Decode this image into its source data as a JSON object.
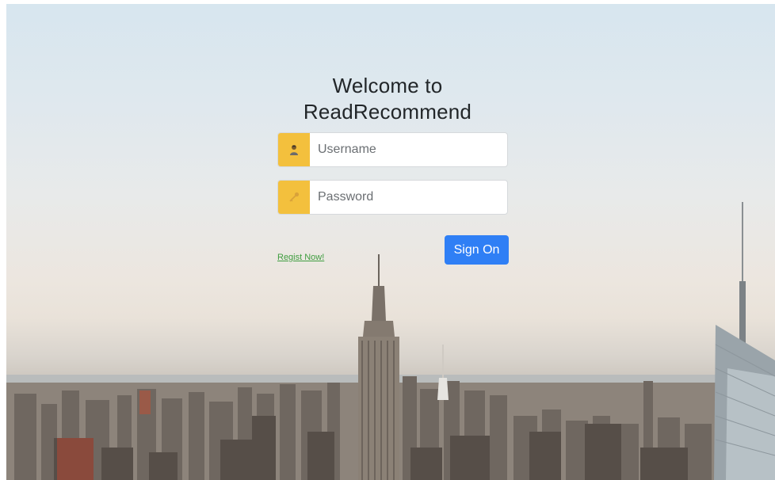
{
  "page": {
    "title_line1": "Welcome to",
    "title_line2": "ReadRecommend"
  },
  "form": {
    "username_placeholder": "Username",
    "password_placeholder": "Password",
    "register_link": "Regist Now!",
    "submit_label": "Sign On"
  },
  "icons": {
    "username_icon": "user-icon",
    "password_icon": "key-icon"
  },
  "colors": {
    "addon_bg": "#f3c03d",
    "button_bg": "#2f7ff5",
    "link": "#3f9d3f"
  }
}
